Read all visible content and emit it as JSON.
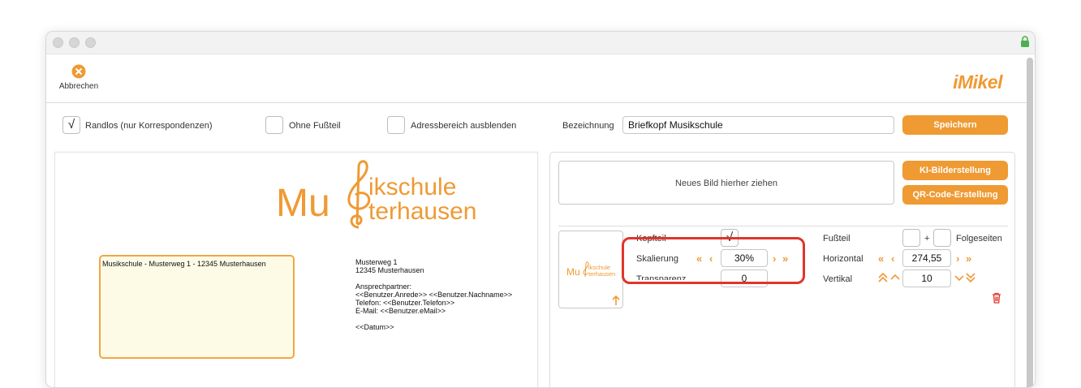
{
  "toolbar": {
    "cancel_label": "Abbrechen",
    "logo_text": "iMikel"
  },
  "options": {
    "randlos": {
      "label": "Randlos (nur Korrespondenzen)",
      "checked": true,
      "mark": "√"
    },
    "ohne_fussteil": {
      "label": "Ohne Fußteil",
      "checked": false
    },
    "adressbereich": {
      "label": "Adressbereich ausblenden",
      "checked": false
    },
    "bezeichnung_label": "Bezeichnung",
    "bezeichnung_value": "Briefkopf Musikschule",
    "save_label": "Speichern"
  },
  "document": {
    "letterhead_line1_a": "Mu",
    "letterhead_line1_b": "ikschule",
    "letterhead_line2": "terhausen",
    "sender_line": "Musikschule - Musterweg 1 - 12345 Musterhausen",
    "address": [
      "Musterweg 1",
      "12345 Musterhausen"
    ],
    "contact_label": "Ansprechpartner:",
    "contact_lines": [
      "<<Benutzer.Anrede>> <<Benutzer.Nachname>>",
      "Telefon: <<Benutzer.Telefon>>",
      "E-Mail: <<Benutzer.eMail>>"
    ],
    "date": "<<Datum>>"
  },
  "image_panel": {
    "drop_text": "Neues Bild hierher ziehen",
    "ai_button": "KI-Bilderstellung",
    "qr_button": "QR-Code-Erstellung",
    "thumb_text_a": "Mu",
    "thumb_text_b": "ikschule",
    "thumb_text_c": "terhausen",
    "kopfteil_label": "Kopfteil",
    "kopfteil_mark": "√",
    "skalierung_label": "Skalierung",
    "skalierung_value": "30%",
    "transparenz_label": "Transparenz",
    "transparenz_value": "0",
    "fussteil_label": "Fußteil",
    "plus": "+",
    "folgeseiten_label": "Folgeseiten",
    "horizontal_label": "Horizontal",
    "horizontal_value": "274,55",
    "vertikal_label": "Vertikal",
    "vertikal_value": "10"
  },
  "colors": {
    "accent": "#ef9a33",
    "highlight": "#e0352b",
    "address_bg": "#fdfbe6"
  }
}
